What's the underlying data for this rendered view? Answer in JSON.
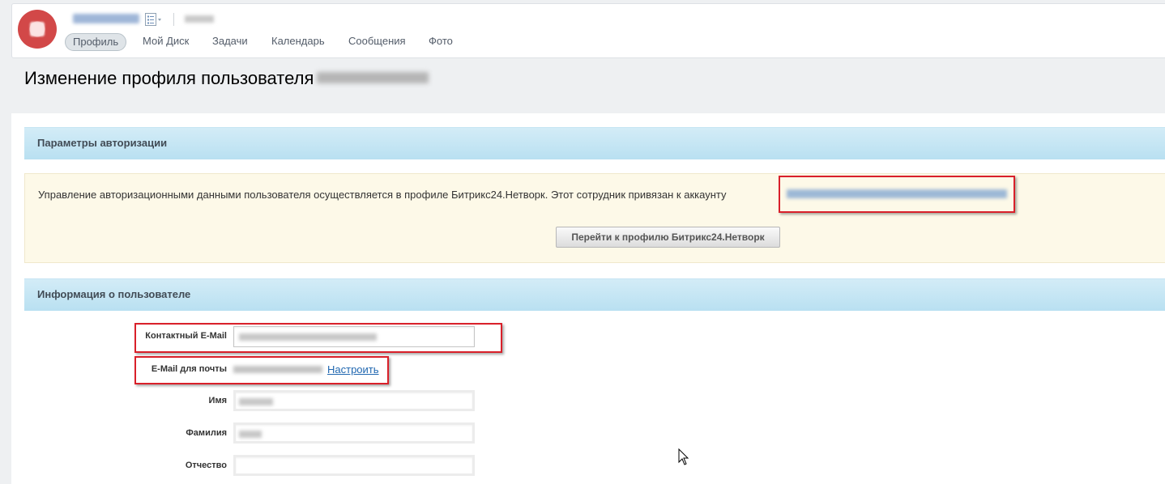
{
  "header": {
    "nav": [
      {
        "label": "Профиль",
        "active": true
      },
      {
        "label": "Мой Диск",
        "active": false
      },
      {
        "label": "Задачи",
        "active": false
      },
      {
        "label": "Календарь",
        "active": false
      },
      {
        "label": "Сообщения",
        "active": false
      },
      {
        "label": "Фото",
        "active": false
      }
    ],
    "list_icon": "list-menu-icon"
  },
  "page": {
    "title": "Изменение профиля пользователя"
  },
  "auth_section": {
    "title": "Параметры авторизации",
    "notice": "Управление авторизационными данными пользователя осуществляется в профиле Битрикс24.Нетворк. Этот сотрудник привязан к аккаунту",
    "button_label": "Перейти к профилю Битрикс24.Нетворк"
  },
  "user_section": {
    "title": "Информация о пользователе",
    "fields": {
      "contact_email_label": "Контактный E-Mail",
      "mail_email_label": "E-Mail для почты",
      "setup_link": "Настроить",
      "first_name_label": "Имя",
      "last_name_label": "Фамилия",
      "middle_name_label": "Отчество"
    }
  },
  "colors": {
    "section_header": "#c3e5f4",
    "notice_bg": "#fdf9e8",
    "highlight_border": "#d9202a",
    "link": "#2067b0"
  }
}
